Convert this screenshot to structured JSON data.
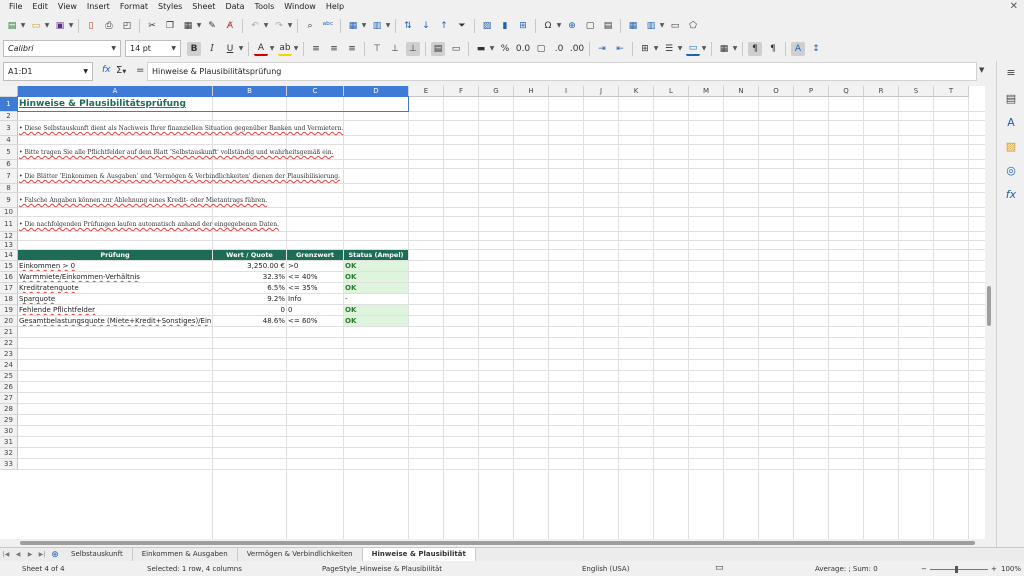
{
  "menu": [
    "File",
    "Edit",
    "View",
    "Insert",
    "Format",
    "Styles",
    "Sheet",
    "Data",
    "Tools",
    "Window",
    "Help"
  ],
  "font": {
    "name": "Calibri",
    "size": "14 pt"
  },
  "name_box": "A1:D1",
  "formula": "Hinweise & Plausibilitätsprüfung",
  "columns": [
    {
      "label": "A",
      "sel": true
    },
    {
      "label": "B",
      "sel": true
    },
    {
      "label": "C",
      "sel": true
    },
    {
      "label": "D",
      "sel": true
    },
    {
      "label": "E"
    },
    {
      "label": "F"
    },
    {
      "label": "G"
    },
    {
      "label": "H"
    },
    {
      "label": "I"
    },
    {
      "label": "J"
    },
    {
      "label": "K"
    },
    {
      "label": "L"
    },
    {
      "label": "M"
    },
    {
      "label": "N"
    },
    {
      "label": "O"
    },
    {
      "label": "P"
    },
    {
      "label": "Q"
    },
    {
      "label": "R"
    },
    {
      "label": "S"
    },
    {
      "label": "T"
    }
  ],
  "rows": [
    "1",
    "2",
    "3",
    "4",
    "5",
    "6",
    "7",
    "8",
    "9",
    "10",
    "11",
    "12",
    "13",
    "14",
    "15",
    "16",
    "17",
    "18",
    "19",
    "20",
    "21",
    "22",
    "23",
    "24",
    "25",
    "26",
    "27",
    "28",
    "29",
    "30",
    "31",
    "32",
    "33"
  ],
  "sheet": {
    "title": "Hinweise & Plausibilitätsprüfung",
    "notes": {
      "r3": "• Diese Selbstauskunft dient als Nachweis Ihrer finanziellen Situation gegenüber Banken und Vermietern.",
      "r5": "• Bitte tragen Sie alle Pflichtfelder auf dem Blatt 'Selbstauskunft' vollständig und wahrheitsgemäß ein.",
      "r7": "• Die Blätter 'Einkommen & Ausgaben' und 'Vermögen & Verbindlichkeiten' dienen der Plausibilisierung.",
      "r9": "• Falsche Angaben können zur Ablehnung eines Kredit- oder Mietantrags führen.",
      "r11": "• Die nachfolgenden Prüfungen laufen automatisch anhand der eingegebenen Daten."
    },
    "table_headers": {
      "a": "Prüfung",
      "b": "Wert / Quote",
      "c": "Grenzwert",
      "d": "Status (Ampel)"
    },
    "table_rows": [
      {
        "a": "Einkommen > 0",
        "b": "3,250.00 €",
        "c": ">0",
        "d": "OK",
        "ok": true
      },
      {
        "a": "Warmmiete/Einkommen-Verhältnis",
        "b": "32.3%",
        "c": "<= 40%",
        "d": "OK",
        "ok": true
      },
      {
        "a": "Kreditratenquote",
        "b": "6.5%",
        "c": "<= 35%",
        "d": "OK",
        "ok": true
      },
      {
        "a": "Sparquote",
        "b": "9.2%",
        "c": "Info",
        "d": "-",
        "ok": false
      },
      {
        "a": "Fehlende Pflichtfelder",
        "b": "0",
        "c": "0",
        "d": "OK",
        "ok": true
      },
      {
        "a": "Gesamtbelastungsquote (Miete+Kredit+Sonstiges)/Eink",
        "b": "48.6%",
        "c": "<= 60%",
        "d": "OK",
        "ok": true
      }
    ]
  },
  "tabs": [
    {
      "label": "Selbstauskunft",
      "active": false
    },
    {
      "label": "Einkommen & Ausgaben",
      "active": false
    },
    {
      "label": "Vermögen & Verbindlichkeiten",
      "active": false
    },
    {
      "label": "Hinweise & Plausibilität",
      "active": true
    }
  ],
  "status": {
    "sheet": "Sheet 4 of 4",
    "selection": "Selected: 1 row, 4 columns",
    "pagestyle": "PageStyle_Hinweise & Plausibilität",
    "language": "English (USA)",
    "sum": "Average: ; Sum: 0",
    "zoom": "100%"
  }
}
